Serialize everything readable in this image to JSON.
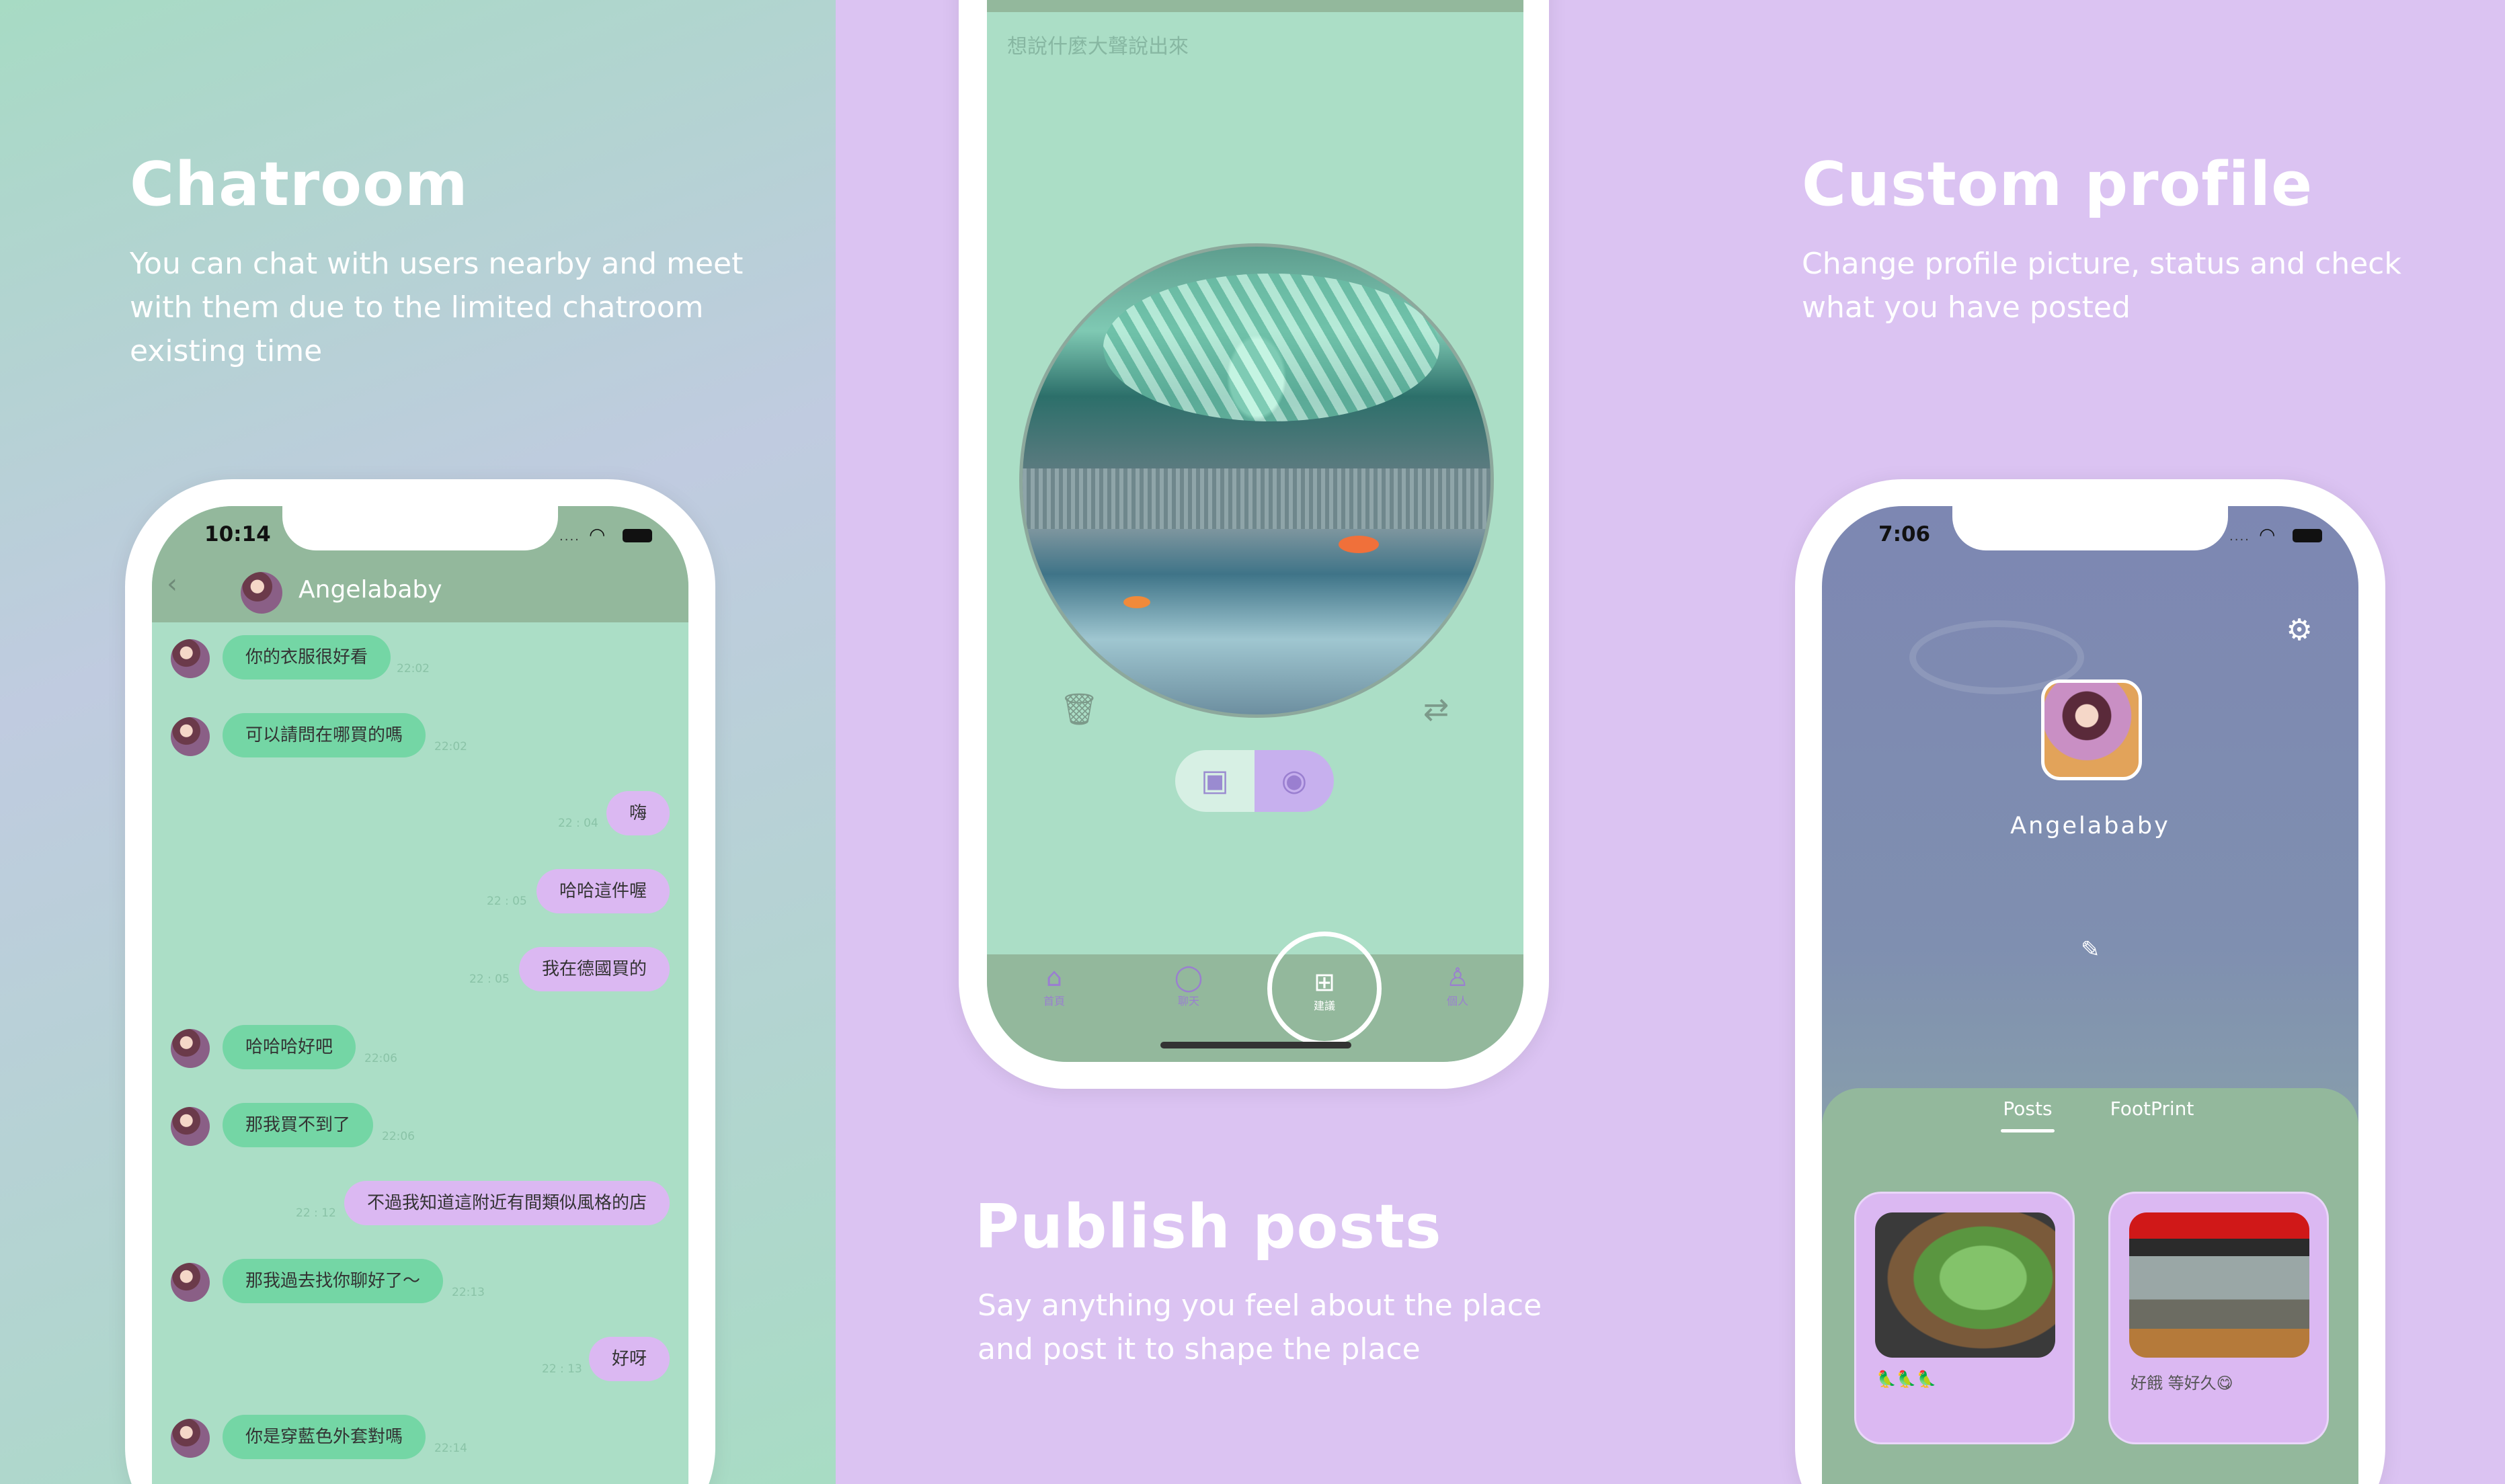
{
  "panels": {
    "chatroom": {
      "title": "Chatroom",
      "desc_lines": [
        "You can chat with users nearby and meet",
        "with them due to the limited chatroom",
        "existing time"
      ],
      "status_time": "10:14",
      "contact_name": "Angelababy",
      "messages": [
        {
          "dir": "in",
          "text": "你的衣服很好看",
          "time": "22:02"
        },
        {
          "dir": "in",
          "text": "可以請問在哪買的嗎",
          "time": "22:02"
        },
        {
          "dir": "out",
          "text": "嗨",
          "time": "22 : 04"
        },
        {
          "dir": "out",
          "text": "哈哈這件喔",
          "time": "22 : 05"
        },
        {
          "dir": "out",
          "text": "我在德國買的",
          "time": "22 : 05"
        },
        {
          "dir": "in",
          "text": "哈哈哈好吧",
          "time": "22:06"
        },
        {
          "dir": "in",
          "text": "那我買不到了",
          "time": "22:06"
        },
        {
          "dir": "out",
          "text": "不過我知道這附近有間類似風格的店",
          "time": "22 : 12"
        },
        {
          "dir": "in",
          "text": "那我過去找你聊好了～",
          "time": "22:13"
        },
        {
          "dir": "out",
          "text": "好呀",
          "time": "22 : 13"
        },
        {
          "dir": "in",
          "text": "你是穿藍色外套對嗎",
          "time": "22:14"
        }
      ]
    },
    "publish": {
      "title": "Publish posts",
      "desc_lines": [
        "Say anything you feel about the place",
        "and post it to shape the place"
      ],
      "input_placeholder": "想說什麼大聲說出來",
      "tabs": [
        {
          "label": "首頁",
          "icon": "home-icon"
        },
        {
          "label": "聊天",
          "icon": "chat-icon"
        },
        {
          "label": "建議",
          "icon": "add-post-icon"
        },
        {
          "label": "個人",
          "icon": "person-icon"
        }
      ]
    },
    "profile": {
      "title": "Custom profile",
      "desc_lines": [
        "Change profile picture, status and check",
        "what you have posted"
      ],
      "status_time": "7:06",
      "username": "Angelababy",
      "tabs": [
        "Posts",
        "FootPrint"
      ],
      "posts": [
        {
          "caption": "🦜🦜🦜"
        },
        {
          "caption": "好餓 等好久😋"
        }
      ]
    }
  },
  "colors": {
    "mint": "#abdec6",
    "purple": "#dbc3f2",
    "chat_green": "#74d6a5",
    "chat_purple": "#dbb8f2",
    "bar_green": "#93b89c"
  }
}
